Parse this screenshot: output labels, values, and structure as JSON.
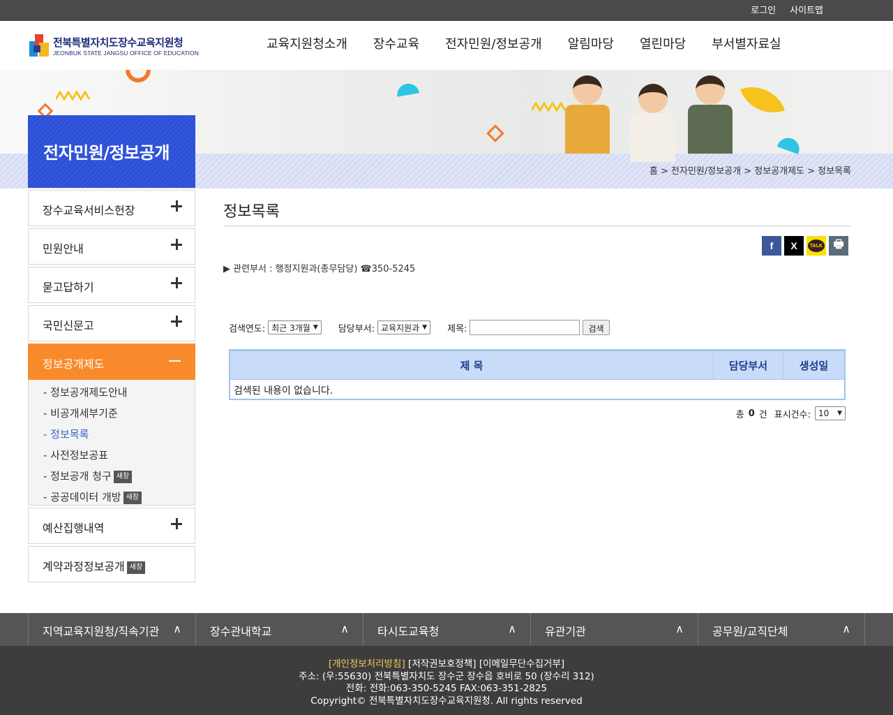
{
  "topbar": {
    "login": "로그인",
    "sitemap": "사이트맵"
  },
  "logo": {
    "ko": "전북특별자치도장수교육지원청",
    "en": "JEONBUK STATE JANGSU OFFICE OF EDUCATION"
  },
  "gnb": [
    "교육지원청소개",
    "장수교육",
    "전자민원/정보공개",
    "알림마당",
    "열린마당",
    "부서별자료실"
  ],
  "side_title": "전자민원/정보공개",
  "breadcrumb": "홈 > 전자민원/정보공개 > 정보공개제도 > 정보목록",
  "lnb": {
    "items": [
      {
        "label": "장수교육서비스헌장"
      },
      {
        "label": "민원안내"
      },
      {
        "label": "묻고답하기"
      },
      {
        "label": "국민신문고"
      },
      {
        "label": "정보공개제도"
      },
      {
        "label": "예산집행내역"
      },
      {
        "label": "계약과정정보공개"
      }
    ],
    "sub": [
      {
        "label": "- 정보공개제도안내"
      },
      {
        "label": "- 비공개세부기준"
      },
      {
        "label": "- 정보목록"
      },
      {
        "label": "- 사전정보공표"
      },
      {
        "label": "- 정보공개 청구"
      },
      {
        "label": "- 공공데이터 개방"
      }
    ],
    "new_tag": "새창"
  },
  "content": {
    "title": "정보목록",
    "dept": "▶ 관련부서 : 행정지원과(총무담당)  ☎350-5245",
    "share": {
      "facebook": "f",
      "x": "X",
      "kakao": "TALK",
      "print": "🖶"
    }
  },
  "search": {
    "year_label": "검색연도:",
    "year_value": "최근 3개월",
    "dept_label": "담당부서:",
    "dept_value": "교육지원과",
    "title_label": "제목:",
    "title_value": "",
    "button": "검색"
  },
  "table": {
    "headers": [
      "제 목",
      "담당부서",
      "생성일"
    ],
    "empty": "검색된 내용이 없습니다."
  },
  "total": {
    "prefix": "총",
    "count": "0",
    "suffix": "건",
    "per_page_label": "표시건수:",
    "per_page_value": "10"
  },
  "footer_nav": [
    "지역교육지원청/직속기관",
    "장수관내학교",
    "타시도교육청",
    "유관기관",
    "공무원/교직단체"
  ],
  "footer": {
    "privacy": "[개인정보처리방침]",
    "copyright_policy": "[저작권보호정책]",
    "email_policy": "[이메일무단수집거부]",
    "address": "주소: (우:55630) 전북특별자치도 장수군 장수읍 호비로 50 (장수리 312)",
    "phone": "전화: 전화:063-350-5245 FAX:063-351-2825",
    "copyright": "Copyright© 전북특별자치도장수교육지원청. All rights reserved"
  },
  "colors": {
    "accent_orange": "#f98a2b",
    "side_blue": "#2b4fd8",
    "table_header": "#c8dcfa",
    "footer_bg": "#3d3d3d"
  }
}
